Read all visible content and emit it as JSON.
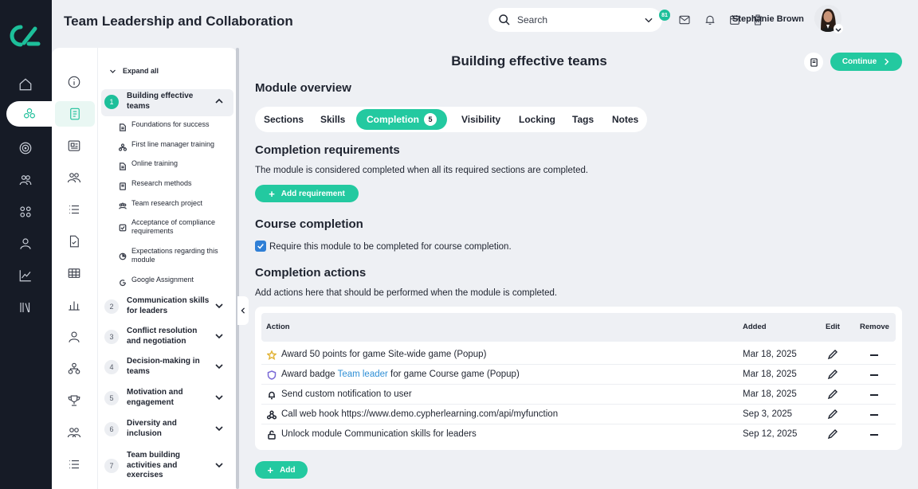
{
  "header": {
    "app_title": "Team Leadership and Collaboration",
    "search_placeholder": "Search",
    "notification_count": "81",
    "user_name": "Stephanie Brown"
  },
  "outline": {
    "expand_all": "Expand all",
    "modules": [
      {
        "num": "1",
        "title": "Building effective teams",
        "expanded": true,
        "sections": [
          {
            "icon": "doc-icon",
            "label": "Foundations for success"
          },
          {
            "icon": "org-icon",
            "label": "First line manager training"
          },
          {
            "icon": "doc-icon",
            "label": "Online training"
          },
          {
            "icon": "book-icon",
            "label": "Research methods"
          },
          {
            "icon": "team-icon",
            "label": "Team research project"
          },
          {
            "icon": "checkbox-icon",
            "label": "Acceptance of compliance requirements"
          },
          {
            "icon": "pie-icon",
            "label": "Expectations regarding this module"
          },
          {
            "icon": "google-icon",
            "label": "Google Assignment"
          }
        ]
      },
      {
        "num": "2",
        "title": "Communication skills for leaders"
      },
      {
        "num": "3",
        "title": "Conflict resolution and negotiation"
      },
      {
        "num": "4",
        "title": "Decision-making in teams"
      },
      {
        "num": "5",
        "title": "Motivation and engagement"
      },
      {
        "num": "6",
        "title": "Diversity and inclusion"
      },
      {
        "num": "7",
        "title": "Team building activities and exercises"
      }
    ]
  },
  "main": {
    "page_title": "Building effective teams",
    "continue_label": "Continue",
    "module_overview": "Module overview",
    "tabs": [
      {
        "label": "Sections"
      },
      {
        "label": "Skills"
      },
      {
        "label": "Completion",
        "count": "5",
        "active": true
      },
      {
        "label": "Visibility"
      },
      {
        "label": "Locking"
      },
      {
        "label": "Tags"
      },
      {
        "label": "Notes"
      }
    ],
    "completion_requirements": {
      "heading": "Completion requirements",
      "description": "The module is considered completed when all its required sections are completed.",
      "add_label": "Add requirement"
    },
    "course_completion": {
      "heading": "Course completion",
      "checkbox_label": "Require this module to be completed for course completion.",
      "checked": true
    },
    "completion_actions": {
      "heading": "Completion actions",
      "description": "Add actions here that should be performed when the module is completed.",
      "columns": {
        "action": "Action",
        "added": "Added",
        "edit": "Edit",
        "remove": "Remove"
      },
      "rows": [
        {
          "icon": "star-icon",
          "pre": "Award 50 points for game Site-wide game (Popup)",
          "link": "",
          "post": "",
          "added": "Mar 18, 2025"
        },
        {
          "icon": "badge-icon",
          "pre": "Award badge ",
          "link": "Team leader",
          "post": " for game Course game (Popup)",
          "added": "Mar 18, 2025"
        },
        {
          "icon": "bell-icon",
          "pre": "Send custom notification to user",
          "link": "",
          "post": "",
          "added": "Mar 18, 2025"
        },
        {
          "icon": "webhook-icon",
          "pre": "Call web hook https://www.demo.cypherlearning.com/api/myfunction",
          "link": "",
          "post": "",
          "added": "Sep 3, 2025"
        },
        {
          "icon": "unlock-icon",
          "pre": "Unlock module Communication skills for leaders",
          "link": "",
          "post": "",
          "added": "Sep 12, 2025"
        }
      ],
      "add_label": "Add"
    }
  },
  "colors": {
    "accent": "#23c9a0",
    "rail": "#161b26",
    "link": "#2f8fd6",
    "checkbox": "#2f7fd6"
  }
}
